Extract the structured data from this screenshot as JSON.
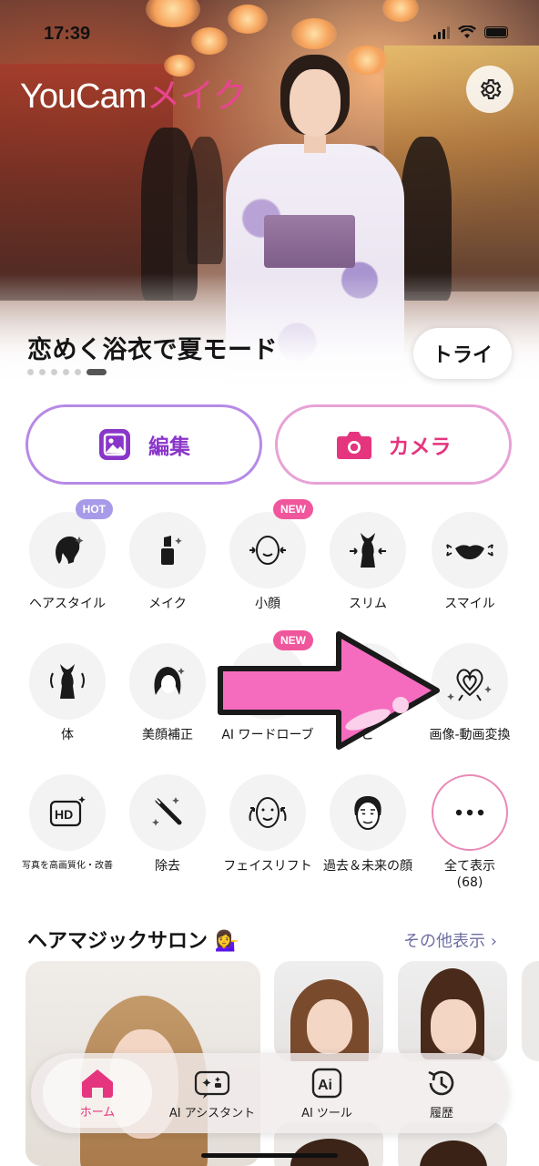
{
  "status_bar": {
    "time": "17:39"
  },
  "header": {
    "logo_a": "YouCam",
    "logo_b": "メイク",
    "settings_icon": "gear-icon"
  },
  "hero": {
    "title": "恋めく浴衣で夏モード",
    "try_label": "トライ",
    "slide_count": 6,
    "active_slide": 6
  },
  "main_actions": {
    "edit_label": "編集",
    "camera_label": "カメラ"
  },
  "features": [
    {
      "label": "ヘアスタイル",
      "icon": "hairstyle-icon",
      "badge": "HOT"
    },
    {
      "label": "メイク",
      "icon": "lipstick-icon"
    },
    {
      "label": "小顔",
      "icon": "small-face-icon",
      "badge": "NEW"
    },
    {
      "label": "スリム",
      "icon": "slim-body-icon"
    },
    {
      "label": "スマイル",
      "icon": "smile-icon"
    },
    {
      "label": "体",
      "icon": "body-icon"
    },
    {
      "label": "美顔補正",
      "icon": "face-retouch-icon"
    },
    {
      "label": "AI ワードローブ",
      "icon": "wardrobe-icon",
      "badge": "NEW"
    },
    {
      "label": "ご",
      "icon": "feature-icon"
    },
    {
      "label": "画像-動画変換",
      "icon": "image-to-video-icon"
    },
    {
      "label": "写真を高画質化・改善",
      "icon": "hd-icon"
    },
    {
      "label": "除去",
      "icon": "eraser-icon"
    },
    {
      "label": "フェイスリフト",
      "icon": "face-lift-icon"
    },
    {
      "label": "過去＆未来の顔",
      "icon": "aging-face-icon"
    },
    {
      "label": "全て表示\n(68)",
      "icon": "more-dots-icon"
    }
  ],
  "hair_section": {
    "title": "ヘアマジックサロン 💁‍♀️",
    "more_label": "その他表示 ›"
  },
  "bottom_nav": [
    {
      "label": "ホーム",
      "icon": "home-icon",
      "active": true
    },
    {
      "label": "AI アシスタント",
      "icon": "ai-assistant-icon"
    },
    {
      "label": "AI ツール",
      "icon": "ai-tool-icon"
    },
    {
      "label": "履歴",
      "icon": "history-icon"
    }
  ],
  "colors": {
    "accent_pink": "#e5357f",
    "accent_purple": "#8a35c9",
    "badge_hot": "#a79be9",
    "badge_new": "#f0569c"
  }
}
